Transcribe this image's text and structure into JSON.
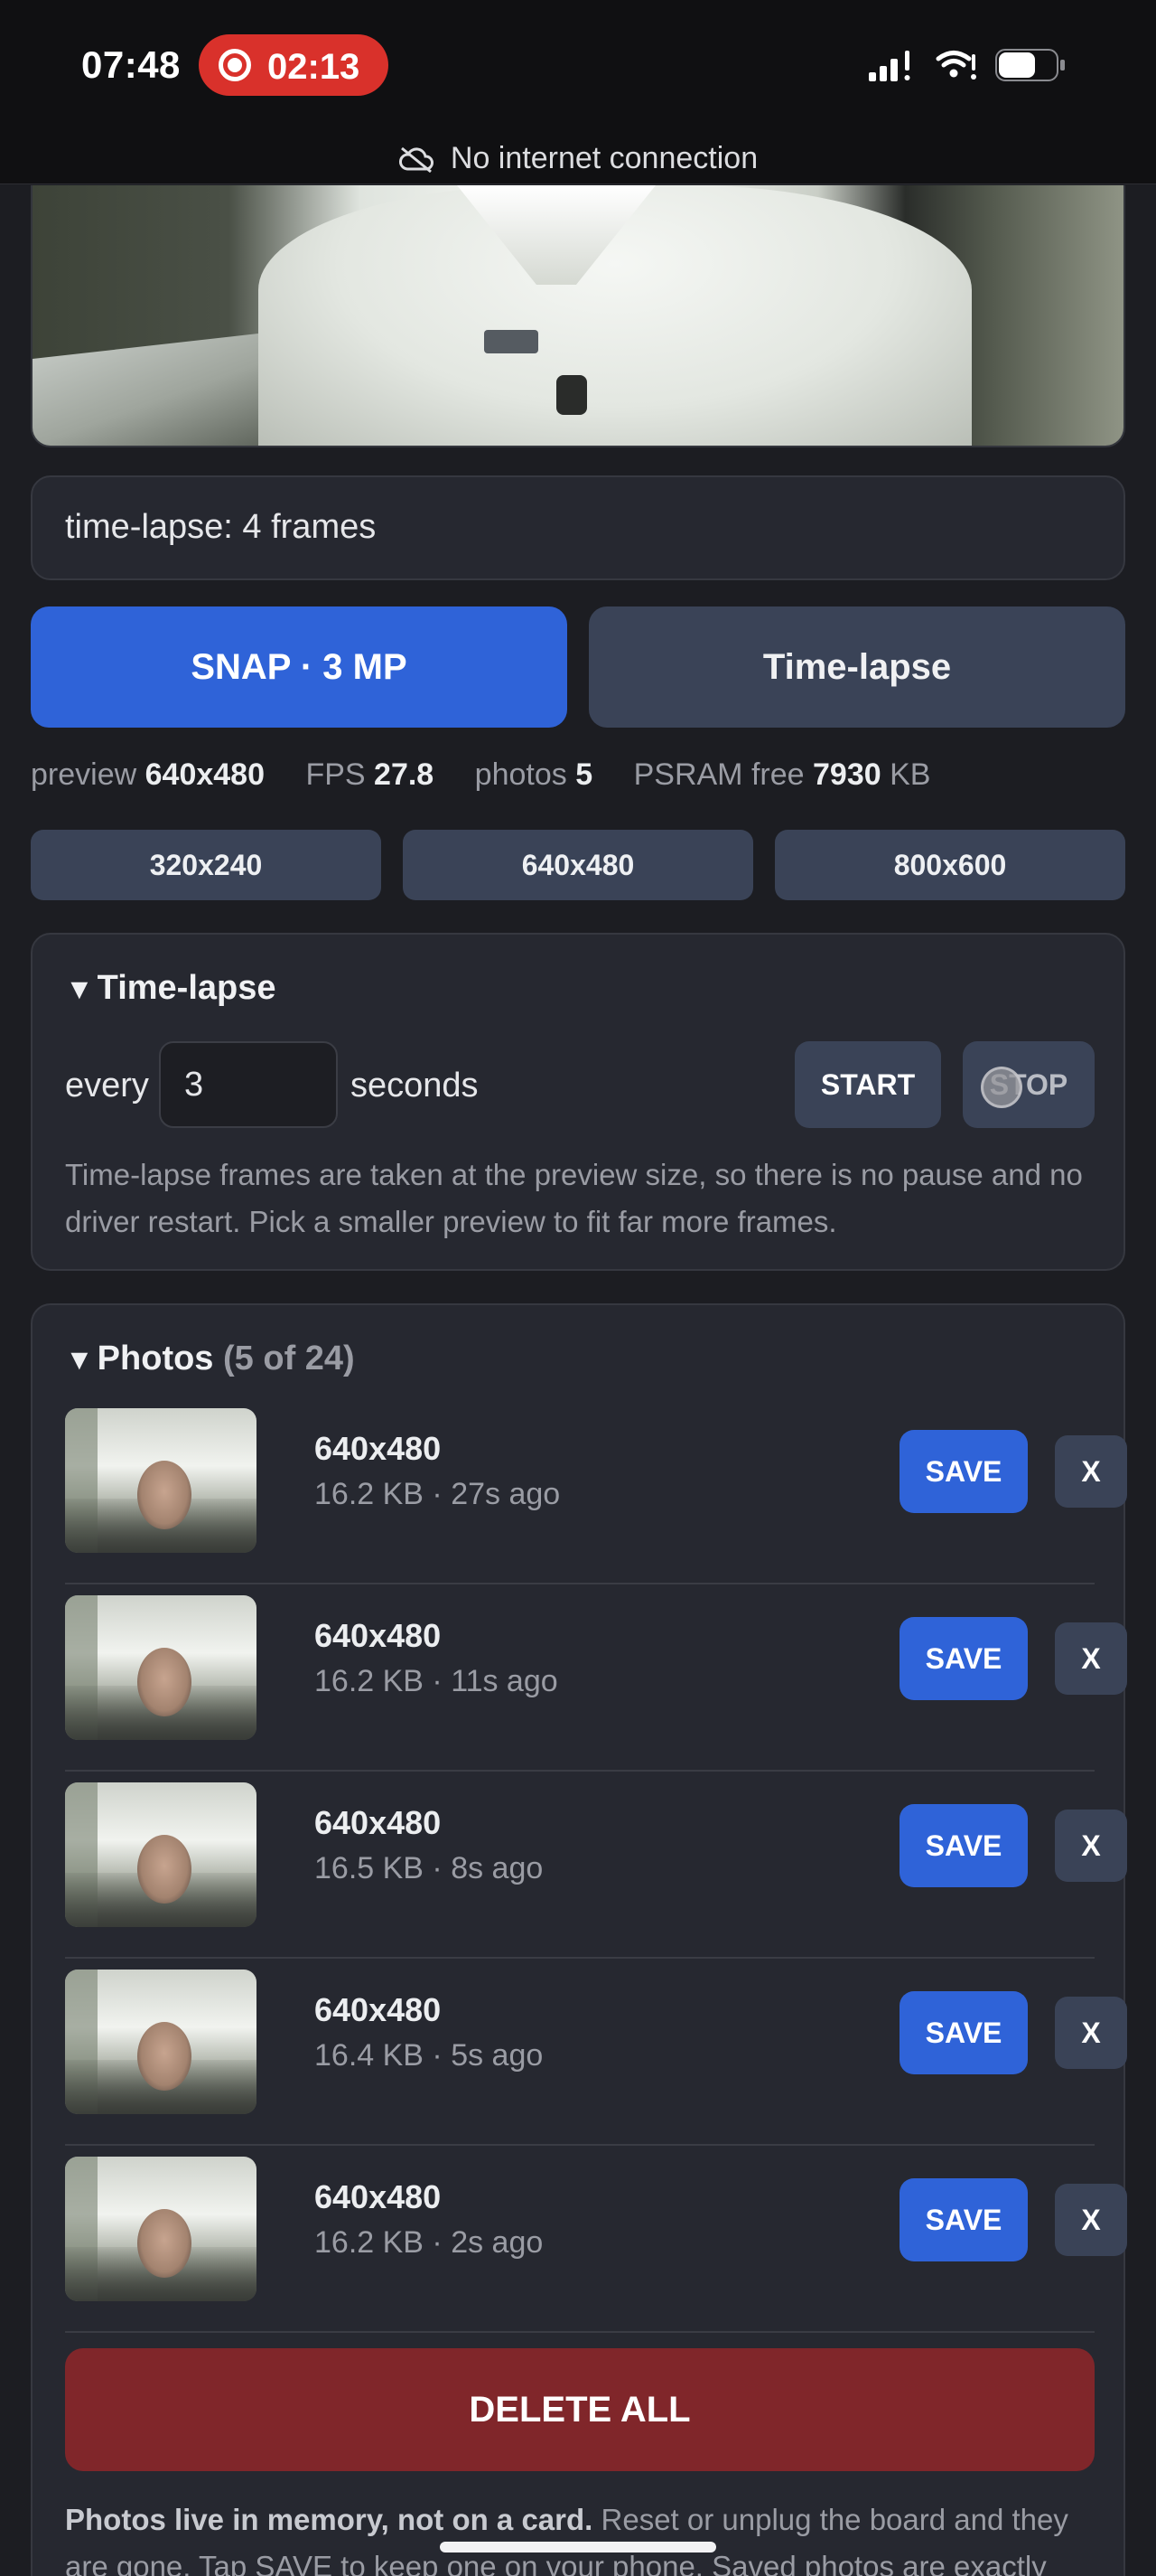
{
  "status_bar": {
    "time": "07:48",
    "recording_time": "02:13",
    "offline_text": "No internet connection",
    "icons": [
      "recording-icon",
      "cellular-signal-icon",
      "wifi-icon",
      "battery-icon",
      "cloud-off-icon"
    ]
  },
  "capture_status": "time-lapse: 4 frames",
  "actions": {
    "snap_label": "SNAP · 3 MP",
    "timelapse_label": "Time-lapse"
  },
  "stats": {
    "preview_label": "preview",
    "preview_value": "640x480",
    "fps_label": "FPS",
    "fps_value": "27.8",
    "photos_label": "photos",
    "photos_value": "5",
    "psram_label": "PSRAM free",
    "psram_value": "7930",
    "psram_unit": "KB"
  },
  "resolutions": [
    "320x240",
    "640x480",
    "800x600"
  ],
  "timelapse": {
    "title": "Time-lapse",
    "every_label": "every",
    "interval_value": "3",
    "seconds_label": "seconds",
    "start_label": "START",
    "stop_label": "STOP",
    "help": "Time-lapse frames are taken at the preview size, so there is no pause and no driver restart. Pick a smaller preview to fit far more frames."
  },
  "photos": {
    "title": "Photos",
    "count": "(5 of 24)",
    "save_label": "SAVE",
    "delete_label": "X",
    "items": [
      {
        "resolution": "640x480",
        "meta": "16.2 KB · 27s ago"
      },
      {
        "resolution": "640x480",
        "meta": "16.2 KB · 11s ago"
      },
      {
        "resolution": "640x480",
        "meta": "16.5 KB · 8s ago"
      },
      {
        "resolution": "640x480",
        "meta": "16.4 KB · 5s ago"
      },
      {
        "resolution": "640x480",
        "meta": "16.2 KB · 2s ago"
      }
    ],
    "delete_all_label": "DELETE ALL",
    "footnote_bold": "Photos live in memory, not on a card.",
    "footnote_rest": " Reset or unplug the board and they are gone. Tap SAVE to keep one on your phone. Saved photos are exactly"
  },
  "colors": {
    "background": "#1c1d22",
    "card": "#262830",
    "primary": "#2f63d8",
    "secondary": "#3a4357",
    "danger": "#80262a",
    "recording": "#d9312b"
  }
}
